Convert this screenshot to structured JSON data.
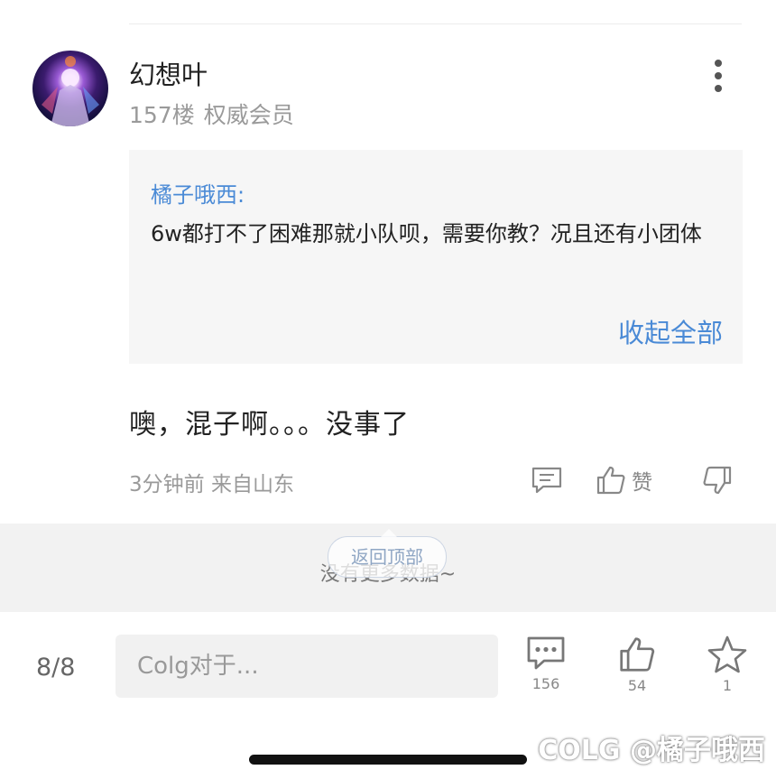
{
  "post": {
    "username": "幻想叶",
    "floor": "157楼",
    "role": "权威会员",
    "quote": {
      "author": "橘子哦西:",
      "text": "6w都打不了困难那就小队呗，需要你教？况且还有小团体",
      "collapse_label": "收起全部"
    },
    "body": "噢，混子啊。。。没事了",
    "time": "3分钟前",
    "location": "来自山东",
    "like_label": "赞"
  },
  "list_footer": {
    "no_more": "没有更多数据~",
    "back_to_top": "返回顶部"
  },
  "bottom_bar": {
    "page_indicator": "8/8",
    "input_placeholder": "Colg对于...",
    "comments_count": "156",
    "likes_count": "54",
    "favorites_count": "1"
  },
  "watermark": "COLG @橘子哦西",
  "colors": {
    "link_blue": "#4a8ad6",
    "meta_grey": "#9a9a9a",
    "quote_bg": "#f6f6f6",
    "band_grey": "#f2f2f2"
  },
  "icons": [
    "more-vertical-icon",
    "reply-icon",
    "thumbs-up-icon",
    "thumbs-down-icon",
    "comment-icon",
    "star-icon"
  ]
}
